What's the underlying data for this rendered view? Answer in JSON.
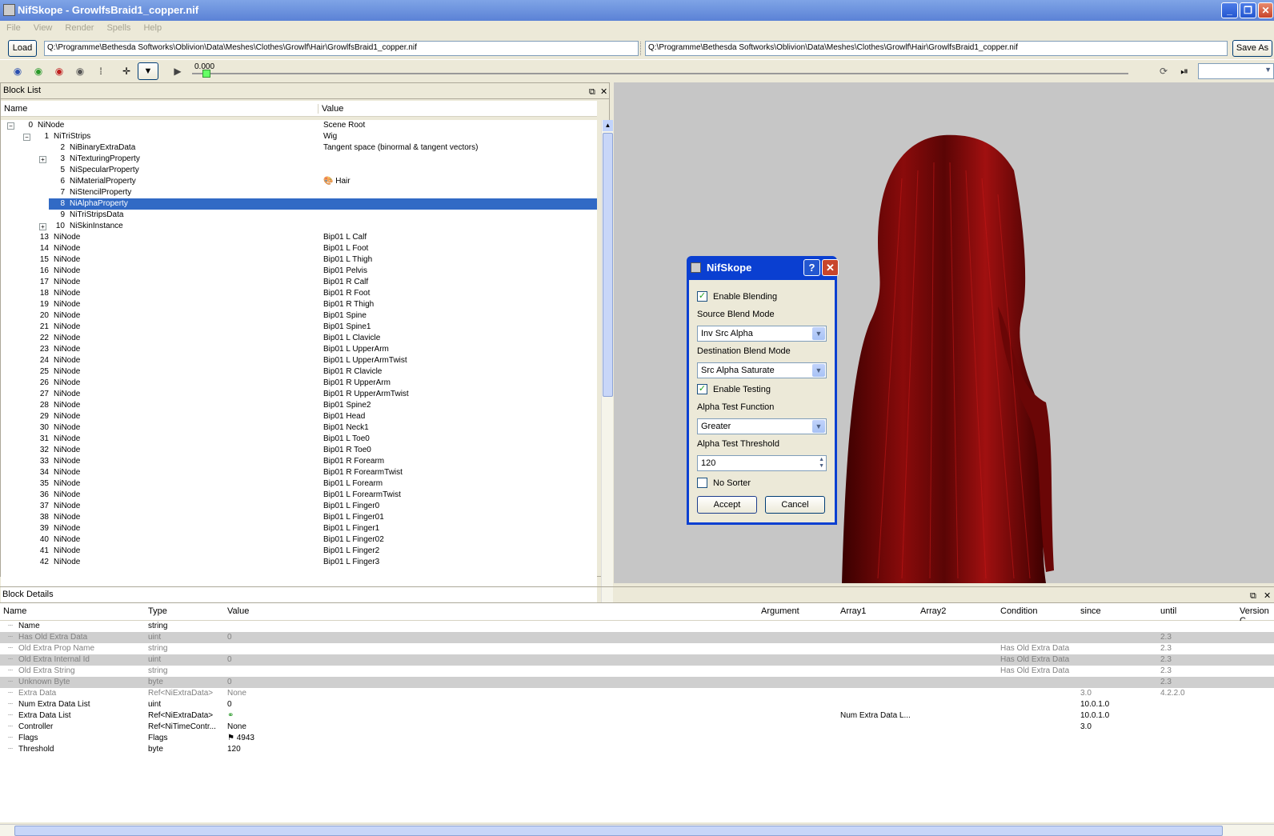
{
  "window": {
    "title": "NifSkope - GrowlfsBraid1_copper.nif"
  },
  "menu": [
    "File",
    "View",
    "Render",
    "Spells",
    "Help"
  ],
  "address": {
    "load_label": "Load",
    "left_path": "Q:\\Programme\\Bethesda Softworks\\Oblivion\\Data\\Meshes\\Clothes\\Growlf\\Hair\\GrowlfsBraid1_copper.nif",
    "right_path": "Q:\\Programme\\Bethesda Softworks\\Oblivion\\Data\\Meshes\\Clothes\\Growlf\\Hair\\GrowlfsBraid1_copper.nif",
    "save_as_label": "Save As"
  },
  "toolbar": {
    "time": "0.000"
  },
  "block_list": {
    "title": "Block List",
    "col_name": "Name",
    "col_value": "Value",
    "rows": [
      {
        "num": "0",
        "name": "NiNode",
        "value": "Scene Root",
        "level": 0,
        "exp": "-"
      },
      {
        "num": "1",
        "name": "NiTriStrips",
        "value": "Wig",
        "level": 1,
        "exp": "-"
      },
      {
        "num": "2",
        "name": "NiBinaryExtraData",
        "value": "Tangent space (binormal & tangent vectors)",
        "level": 2,
        "exp": ""
      },
      {
        "num": "3",
        "name": "NiTexturingProperty",
        "value": "",
        "level": 2,
        "exp": "+"
      },
      {
        "num": "5",
        "name": "NiSpecularProperty",
        "value": "",
        "level": 2,
        "exp": ""
      },
      {
        "num": "6",
        "name": "NiMaterialProperty",
        "value": "Hair",
        "level": 2,
        "exp": ""
      },
      {
        "num": "7",
        "name": "NiStencilProperty",
        "value": "",
        "level": 2,
        "exp": ""
      },
      {
        "num": "8",
        "name": "NiAlphaProperty",
        "value": "",
        "level": 2,
        "exp": "",
        "selected": true
      },
      {
        "num": "9",
        "name": "NiTriStripsData",
        "value": "",
        "level": 2,
        "exp": ""
      },
      {
        "num": "10",
        "name": "NiSkinInstance",
        "value": "",
        "level": 2,
        "exp": "+"
      },
      {
        "num": "13",
        "name": "NiNode",
        "value": "Bip01 L Calf",
        "level": 1,
        "exp": ""
      },
      {
        "num": "14",
        "name": "NiNode",
        "value": "Bip01 L Foot",
        "level": 1,
        "exp": ""
      },
      {
        "num": "15",
        "name": "NiNode",
        "value": "Bip01 L Thigh",
        "level": 1,
        "exp": ""
      },
      {
        "num": "16",
        "name": "NiNode",
        "value": "Bip01 Pelvis",
        "level": 1,
        "exp": ""
      },
      {
        "num": "17",
        "name": "NiNode",
        "value": "Bip01 R Calf",
        "level": 1,
        "exp": ""
      },
      {
        "num": "18",
        "name": "NiNode",
        "value": "Bip01 R Foot",
        "level": 1,
        "exp": ""
      },
      {
        "num": "19",
        "name": "NiNode",
        "value": "Bip01 R Thigh",
        "level": 1,
        "exp": ""
      },
      {
        "num": "20",
        "name": "NiNode",
        "value": "Bip01 Spine",
        "level": 1,
        "exp": ""
      },
      {
        "num": "21",
        "name": "NiNode",
        "value": "Bip01 Spine1",
        "level": 1,
        "exp": ""
      },
      {
        "num": "22",
        "name": "NiNode",
        "value": "Bip01 L Clavicle",
        "level": 1,
        "exp": ""
      },
      {
        "num": "23",
        "name": "NiNode",
        "value": "Bip01 L UpperArm",
        "level": 1,
        "exp": ""
      },
      {
        "num": "24",
        "name": "NiNode",
        "value": "Bip01 L UpperArmTwist",
        "level": 1,
        "exp": ""
      },
      {
        "num": "25",
        "name": "NiNode",
        "value": "Bip01 R Clavicle",
        "level": 1,
        "exp": ""
      },
      {
        "num": "26",
        "name": "NiNode",
        "value": "Bip01 R UpperArm",
        "level": 1,
        "exp": ""
      },
      {
        "num": "27",
        "name": "NiNode",
        "value": "Bip01 R UpperArmTwist",
        "level": 1,
        "exp": ""
      },
      {
        "num": "28",
        "name": "NiNode",
        "value": "Bip01 Spine2",
        "level": 1,
        "exp": ""
      },
      {
        "num": "29",
        "name": "NiNode",
        "value": "Bip01 Head",
        "level": 1,
        "exp": ""
      },
      {
        "num": "30",
        "name": "NiNode",
        "value": "Bip01 Neck1",
        "level": 1,
        "exp": ""
      },
      {
        "num": "31",
        "name": "NiNode",
        "value": "Bip01 L Toe0",
        "level": 1,
        "exp": ""
      },
      {
        "num": "32",
        "name": "NiNode",
        "value": "Bip01 R Toe0",
        "level": 1,
        "exp": ""
      },
      {
        "num": "33",
        "name": "NiNode",
        "value": "Bip01 R Forearm",
        "level": 1,
        "exp": ""
      },
      {
        "num": "34",
        "name": "NiNode",
        "value": "Bip01 R ForearmTwist",
        "level": 1,
        "exp": ""
      },
      {
        "num": "35",
        "name": "NiNode",
        "value": "Bip01 L Forearm",
        "level": 1,
        "exp": ""
      },
      {
        "num": "36",
        "name": "NiNode",
        "value": "Bip01 L ForearmTwist",
        "level": 1,
        "exp": ""
      },
      {
        "num": "37",
        "name": "NiNode",
        "value": "Bip01 L Finger0",
        "level": 1,
        "exp": ""
      },
      {
        "num": "38",
        "name": "NiNode",
        "value": "Bip01 L Finger01",
        "level": 1,
        "exp": ""
      },
      {
        "num": "39",
        "name": "NiNode",
        "value": "Bip01 L Finger1",
        "level": 1,
        "exp": ""
      },
      {
        "num": "40",
        "name": "NiNode",
        "value": "Bip01 L Finger02",
        "level": 1,
        "exp": ""
      },
      {
        "num": "41",
        "name": "NiNode",
        "value": "Bip01 L Finger2",
        "level": 1,
        "exp": ""
      },
      {
        "num": "42",
        "name": "NiNode",
        "value": "Bip01 L Finger3",
        "level": 1,
        "exp": ""
      }
    ]
  },
  "dialog": {
    "title": "NifSkope",
    "enable_blending": "Enable Blending",
    "source_blend_label": "Source Blend Mode",
    "source_blend_value": "Inv Src Alpha",
    "dest_blend_label": "Destination Blend Mode",
    "dest_blend_value": "Src Alpha Saturate",
    "enable_testing": "Enable Testing",
    "alpha_func_label": "Alpha Test Function",
    "alpha_func_value": "Greater",
    "alpha_threshold_label": "Alpha Test Threshold",
    "alpha_threshold_value": "120",
    "no_sorter": "No Sorter",
    "accept": "Accept",
    "cancel": "Cancel"
  },
  "block_details": {
    "title": "Block Details",
    "columns": [
      "Name",
      "Type",
      "Value",
      "Argument",
      "Array1",
      "Array2",
      "Condition",
      "since",
      "until",
      "Version C"
    ],
    "rows": [
      {
        "name": "Name",
        "type": "string",
        "value": "",
        "array1": "",
        "cond": "",
        "since": "",
        "until": "",
        "style": ""
      },
      {
        "name": "Has Old Extra Data",
        "type": "uint",
        "value": "0",
        "array1": "",
        "cond": "",
        "since": "",
        "until": "2.3",
        "style": "gray"
      },
      {
        "name": "Old Extra Prop Name",
        "type": "string",
        "value": "",
        "array1": "",
        "cond": "Has Old Extra Data",
        "since": "",
        "until": "2.3",
        "style": "dim"
      },
      {
        "name": "Old Extra Internal Id",
        "type": "uint",
        "value": "0",
        "array1": "",
        "cond": "Has Old Extra Data",
        "since": "",
        "until": "2.3",
        "style": "gray"
      },
      {
        "name": "Old Extra String",
        "type": "string",
        "value": "",
        "array1": "",
        "cond": "Has Old Extra Data",
        "since": "",
        "until": "2.3",
        "style": "dim"
      },
      {
        "name": "Unknown Byte",
        "type": "byte",
        "value": "0",
        "array1": "",
        "cond": "",
        "since": "",
        "until": "2.3",
        "style": "gray"
      },
      {
        "name": "Extra Data",
        "type": "Ref<NiExtraData>",
        "value": "None",
        "array1": "",
        "cond": "",
        "since": "3.0",
        "until": "4.2.2.0",
        "style": "dim"
      },
      {
        "name": "Num Extra Data List",
        "type": "uint",
        "value": "0",
        "array1": "",
        "cond": "",
        "since": "10.0.1.0",
        "until": "",
        "style": ""
      },
      {
        "name": "Extra Data List",
        "type": "Ref<NiExtraData>",
        "value": "",
        "array1": "Num Extra Data L...",
        "cond": "",
        "since": "10.0.1.0",
        "until": "",
        "style": ""
      },
      {
        "name": "Controller",
        "type": "Ref<NiTimeContr...",
        "value": "None",
        "array1": "",
        "cond": "",
        "since": "3.0",
        "until": "",
        "style": ""
      },
      {
        "name": "Flags",
        "type": "Flags",
        "value": "4943",
        "array1": "",
        "cond": "",
        "since": "",
        "until": "",
        "style": ""
      },
      {
        "name": "Threshold",
        "type": "byte",
        "value": "120",
        "array1": "",
        "cond": "",
        "since": "",
        "until": "",
        "style": ""
      }
    ]
  }
}
